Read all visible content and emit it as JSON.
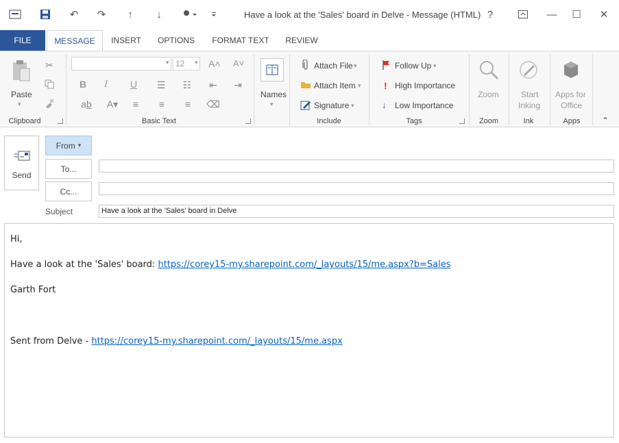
{
  "window": {
    "title": "Have a look at the 'Sales' board in Delve - Message (HTML)",
    "help_label": "?",
    "minimize_label": "—",
    "maximize_label": "☐",
    "close_label": "✕"
  },
  "qat": {
    "save_label": "Save",
    "undo_label": "Undo",
    "redo_label": "Redo",
    "up_label": "Previous Item",
    "down_label": "Next Item",
    "touch_label": "Touch/Mouse Mode"
  },
  "tabs": [
    {
      "label": "FILE"
    },
    {
      "label": "MESSAGE"
    },
    {
      "label": "INSERT"
    },
    {
      "label": "OPTIONS"
    },
    {
      "label": "FORMAT TEXT"
    },
    {
      "label": "REVIEW"
    }
  ],
  "ribbon": {
    "clipboard": {
      "paste_label": "Paste",
      "group_label": "Clipboard"
    },
    "basic_text": {
      "font_size": "12",
      "bold": "B",
      "italic": "I",
      "underline": "U",
      "group_label": "Basic Text"
    },
    "names": {
      "names_label": "Names",
      "group_label": ""
    },
    "include": {
      "attach_file": "Attach File",
      "attach_item": "Attach Item",
      "signature": "Signature",
      "group_label": "Include"
    },
    "tags": {
      "follow_up": "Follow Up",
      "high_importance": "High Importance",
      "low_importance": "Low Importance",
      "group_label": "Tags"
    },
    "zoom": {
      "zoom_label": "Zoom",
      "group_label": "Zoom"
    },
    "ink": {
      "start_inking_1": "Start",
      "start_inking_2": "Inking",
      "group_label": "Ink"
    },
    "apps": {
      "apps_for_office_1": "Apps for",
      "apps_for_office_2": "Office",
      "group_label": "Apps"
    }
  },
  "header": {
    "send_label": "Send",
    "from_label": "From",
    "from_value": "",
    "to_label": "To...",
    "to_value": "",
    "cc_label": "Cc...",
    "cc_value": "",
    "subject_label": "Subject",
    "subject_value": "Have a look at the 'Sales' board in Delve"
  },
  "body": {
    "greeting": "Hi,",
    "line2_text": "Have a look at the 'Sales' board: ",
    "line2_link": "https://corey15-my.sharepoint.com/_layouts/15/me.aspx?b=Sales",
    "signature": "Garth Fort",
    "footer_text": "Sent from Delve - ",
    "footer_link": "https://corey15-my.sharepoint.com/_layouts/15/me.aspx"
  },
  "colors": {
    "accent": "#2b579a",
    "link": "#0563c1",
    "follow_up_flag": "#d9342b",
    "high_importance": "#d9342b",
    "low_importance": "#2b579a",
    "from_button_bg": "#cfe3f7"
  }
}
